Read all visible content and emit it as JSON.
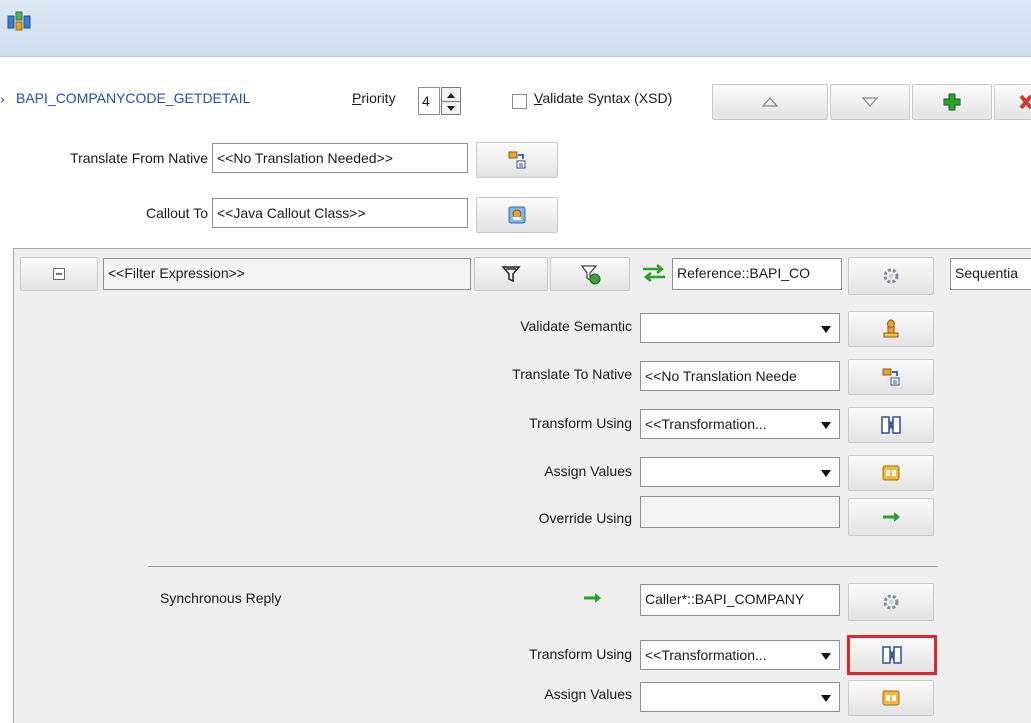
{
  "header": {
    "service_name": "BAPI_COMPANYCODE_GETDETAIL",
    "priority_label": "Priority",
    "priority_value": "4",
    "validate_syntax_label": "Validate Syntax (XSD)"
  },
  "translate_from_native": {
    "label": "Translate From Native",
    "value": "<<No Translation Needed>>"
  },
  "callout_to": {
    "label": "Callout To",
    "value": "<<Java Callout Class>>"
  },
  "filter": {
    "expression": "<<Filter Expression>>",
    "target": "Reference::BAPI_CO",
    "execution": "Sequentia"
  },
  "request": {
    "validate_semantic_label": "Validate Semantic",
    "validate_semantic_value": "",
    "translate_to_native_label": "Translate To Native",
    "translate_to_native_value": "<<No Translation Neede",
    "transform_using_label": "Transform Using",
    "transform_using_value": "<<Transformation...",
    "assign_values_label": "Assign Values",
    "assign_values_value": "",
    "override_using_label": "Override Using",
    "override_using_value": ""
  },
  "reply": {
    "title": "Synchronous Reply",
    "target": "Caller*::BAPI_COMPANY",
    "transform_using_label": "Transform Using",
    "transform_using_value": "<<Transformation...",
    "assign_values_label": "Assign Values",
    "assign_values_value": ""
  },
  "colors": {
    "accent_link": "#1f4fb3",
    "highlight": "#e0252c",
    "add_green": "#2aa12a",
    "remove_red": "#d23a2a"
  }
}
